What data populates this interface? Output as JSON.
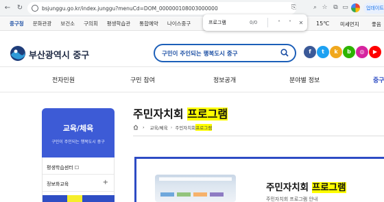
{
  "browser": {
    "url": "bsjunggu.go.kr/index.junggu?menuCd=DOM_000000108003000000",
    "update_label": "업데이트"
  },
  "quicklinks": {
    "items": [
      "중구청",
      "문화관광",
      "보건소",
      "구의회",
      "평생학습관",
      "통합예약",
      "나이스중구"
    ],
    "weather": "15℃",
    "weather_extra": "미세먼지",
    "more": "좋음"
  },
  "findbar": {
    "query": "프로그램",
    "count": "0/0"
  },
  "header": {
    "logo_text": "부산광역시 중구",
    "search_placeholder": "구민이 주인되는 행복도시 중구",
    "sns": [
      {
        "name": "facebook",
        "glyph": "f",
        "color": "#3b5998"
      },
      {
        "name": "twitter",
        "glyph": "t",
        "color": "#1da1f2"
      },
      {
        "name": "kakaostory",
        "glyph": "k",
        "color": "#f0a81e"
      },
      {
        "name": "blog",
        "glyph": "b",
        "color": "#2db400"
      },
      {
        "name": "instagram",
        "glyph": "◎",
        "color": "#d6249f"
      },
      {
        "name": "youtube",
        "glyph": "▶",
        "color": "#ff0000"
      }
    ]
  },
  "gnb": {
    "items": [
      "전자민원",
      "구민 참여",
      "정보공개",
      "분야별 정보",
      "중구"
    ]
  },
  "sidebar": {
    "title": "교육/체육",
    "subtitle": "구민이 주인되는 행복도시 중구",
    "items": [
      {
        "label": "평생학습센터 ☐"
      },
      {
        "label": "정보화교육"
      }
    ]
  },
  "content": {
    "title_prefix": "주민자치회 ",
    "title_highlight": "프로그램",
    "breadcrumb": [
      "교육/체육",
      "주민자치회 "
    ],
    "breadcrumb_highlight": "프로그램",
    "program_title_prefix": "주민자치회 ",
    "program_title_highlight": "프로그램",
    "program_sub": "주민자치회 프로그램 안내"
  }
}
